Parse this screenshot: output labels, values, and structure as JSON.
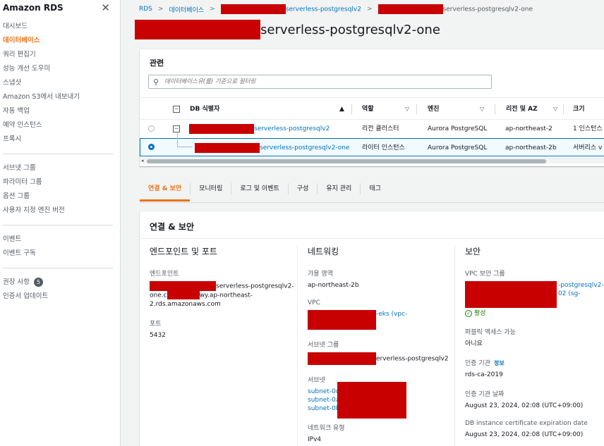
{
  "sidebar": {
    "title": "Amazon RDS",
    "close_glyph": "✕",
    "group1": [
      "대시보드",
      "데이터베이스",
      "쿼리 편집기",
      "성능 개선 도우미",
      "스냅샷",
      "Amazon S3에서 내보내기",
      "자동 백업",
      "예약 인스턴스",
      "프록시"
    ],
    "group2": [
      "서브넷 그룹",
      "파라미터 그룹",
      "옵션 그룹",
      "사용자 지정 엔진 버전"
    ],
    "group3": [
      "이벤트",
      "이벤트 구독"
    ],
    "group4": {
      "recommendations": "권장 사항",
      "recommendations_count": "5",
      "cert_update": "인증서 업데이트"
    }
  },
  "breadcrumb": {
    "rds": "RDS",
    "databases": "데이터베이스",
    "cluster_suffix": "serverless-postgresqlv2",
    "instance_suffix": "serverless-postgresqlv2-one"
  },
  "page_title_suffix": "serverless-postgresqlv2-one",
  "related": {
    "title": "관련",
    "filter_placeholder": "데이터베이스유(를) 기준으로 필터링",
    "columns": {
      "id": "DB 식별자",
      "role": "역할",
      "engine": "엔진",
      "region": "리전 및 AZ",
      "size": "크기"
    },
    "rows": [
      {
        "id_suffix": "serverless-postgresqlv2",
        "role": "리전 클러스터",
        "engine": "Aurora PostgreSQL",
        "region": "ap-northeast-2",
        "size": "1 인스턴스"
      },
      {
        "id_suffix": "serverless-postgresqlv2-one",
        "role": "라이터 인스턴스",
        "engine": "Aurora PostgreSQL",
        "region": "ap-northeast-2b",
        "size": "서버리스 v"
      }
    ]
  },
  "tabs": [
    "연결 & 보안",
    "모니터링",
    "로그 및 이벤트",
    "구성",
    "유지 관리",
    "태그"
  ],
  "conn": {
    "title": "연결 & 보안",
    "endpoint": {
      "heading": "엔드포인트 및 포트",
      "endpoint_label": "엔드포인트",
      "endpoint_line1_suffix": "serverless-postgresqlv2-",
      "endpoint_line2_prefix": "one.c",
      "endpoint_line2_suffix": "wy.ap-northeast-",
      "endpoint_line3": "2.rds.amazonaws.com",
      "port_label": "포트",
      "port": "5432"
    },
    "network": {
      "heading": "네트워킹",
      "az_label": "가용 영역",
      "az": "ap-northeast-2b",
      "vpc_label": "VPC",
      "vpc_suffix": "-eks (vpc-",
      "subnet_group_label": "서브넷 그룹",
      "subnet_group_suffix": "erverless-postgresqlv2",
      "subnets_label": "서브넷",
      "subnets": [
        "subnet-0d",
        "subnet-0a",
        "subnet-0b"
      ],
      "net_type_label": "네트워크 유형",
      "net_type": "IPv4"
    },
    "security": {
      "heading": "보안",
      "sg_label": "VPC 보안 그룹",
      "sg_line1_suffix": "-postgresqlv2-",
      "sg_line2_suffix": "02 (sg-",
      "sg_status": "활성",
      "public_label": "퍼블릭 액세스 가능",
      "public": "아니요",
      "ca_label": "인증 기관",
      "ca_info": "정보",
      "ca": "rds-ca-2019",
      "ca_date_label": "인증 기관 날짜",
      "ca_date": "August 23, 2024, 02:08 (UTC+09:00)",
      "cert_exp_label": "DB instance certificate expiration date",
      "cert_exp": "August 23, 2024, 02:08 (UTC+09:00)"
    }
  }
}
